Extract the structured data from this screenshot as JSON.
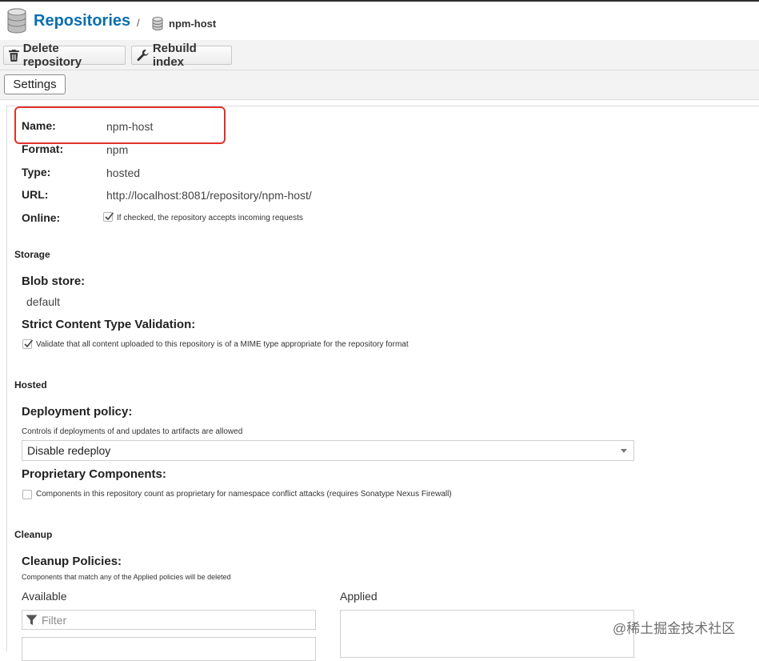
{
  "header": {
    "title": "Repositories",
    "separator": "/",
    "current": "npm-host"
  },
  "toolbar": {
    "delete_label": "Delete repository",
    "rebuild_label": "Rebuild index"
  },
  "tabs": {
    "settings_label": "Settings"
  },
  "summary": {
    "name_label": "Name:",
    "name_value": "npm-host",
    "format_label": "Format:",
    "format_value": "npm",
    "type_label": "Type:",
    "type_value": "hosted",
    "url_label": "URL:",
    "url_value": "http://localhost:8081/repository/npm-host/",
    "online_label": "Online:",
    "online_text": "If checked, the repository accepts incoming requests",
    "online_checked": true
  },
  "storage": {
    "section_title": "Storage",
    "blob_label": "Blob store:",
    "blob_value": "default",
    "strict_label": "Strict Content Type Validation:",
    "strict_text": "Validate that all content uploaded to this repository is of a MIME type appropriate for the repository format",
    "strict_checked": true
  },
  "hosted": {
    "section_title": "Hosted",
    "deploy_label": "Deployment policy:",
    "deploy_help": "Controls if deployments of and updates to artifacts are allowed",
    "deploy_value": "Disable redeploy",
    "proprietary_label": "Proprietary Components:",
    "proprietary_text": "Components in this repository count as proprietary for namespace conflict attacks (requires Sonatype Nexus Firewall)",
    "proprietary_checked": false
  },
  "cleanup": {
    "section_title": "Cleanup",
    "policies_label": "Cleanup Policies:",
    "policies_help": "Components that match any of the Applied policies will be deleted",
    "available_label": "Available",
    "applied_label": "Applied",
    "filter_placeholder": "Filter"
  },
  "watermark": "@稀土掘金技术社区",
  "colors": {
    "accent": "#0b6fb0",
    "highlight": "#e0312b"
  }
}
